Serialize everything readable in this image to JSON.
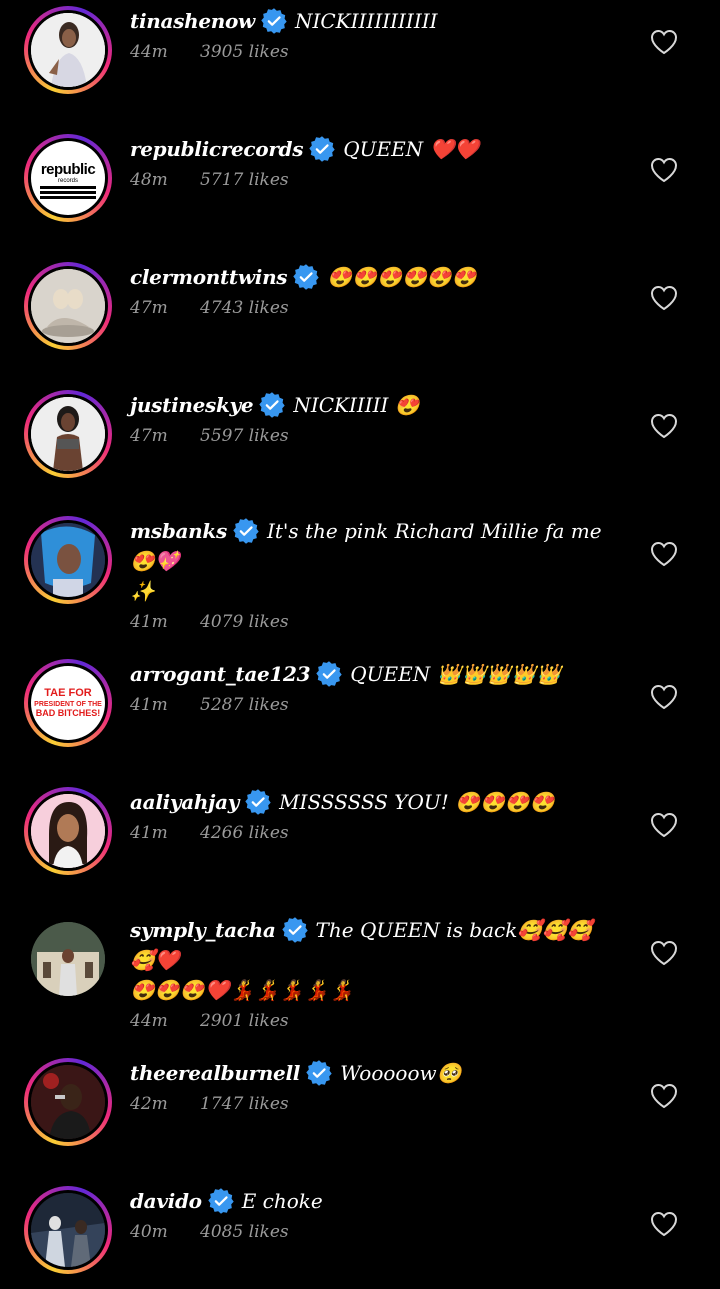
{
  "comments": [
    {
      "user": "tinashenow",
      "text": "NICKIIIIIIIIIII",
      "time": "44m",
      "likes": "3905 likes"
    },
    {
      "user": "republicrecords",
      "text": "QUEEN ❤️❤️",
      "time": "48m",
      "likes": "5717 likes"
    },
    {
      "user": "clermonttwins",
      "text": "😍😍😍😍😍😍",
      "time": "47m",
      "likes": "4743 likes"
    },
    {
      "user": "justineskye",
      "text": "NICKIIIII 😍",
      "time": "47m",
      "likes": "5597 likes"
    },
    {
      "user": "msbanks",
      "text": "It's the pink Richard Millie fa me 😍💖",
      "text2": "✨",
      "time": "41m",
      "likes": "4079 likes"
    },
    {
      "user": "arrogant_tae123",
      "text": "QUEEN 👑👑👑👑👑",
      "time": "41m",
      "likes": "5287 likes"
    },
    {
      "user": "aaliyahjay",
      "text": "MISSSSSS YOU! 😍😍😍😍",
      "time": "41m",
      "likes": "4266 likes"
    },
    {
      "user": "symply_tacha",
      "text": "The QUEEN is back🥰🥰🥰🥰❤️",
      "text2": "😍😍😍❤️💃💃💃💃💃",
      "time": "44m",
      "likes": "2901 likes"
    },
    {
      "user": "theerealburnell",
      "text": "Wooooow🥺",
      "time": "42m",
      "likes": "1747 likes"
    },
    {
      "user": "davido",
      "text": "E choke",
      "time": "40m",
      "likes": "4085 likes"
    }
  ],
  "republic_logo": {
    "word": "republic",
    "sub": "records"
  },
  "tae_avatar": {
    "l1": "TAE FOR",
    "l2": "PRESIDENT OF THE",
    "l3": "BAD BITCHES!"
  },
  "colors": {
    "background": "#000000",
    "meta": "#9a9a9a",
    "verified": "#3897f0"
  }
}
